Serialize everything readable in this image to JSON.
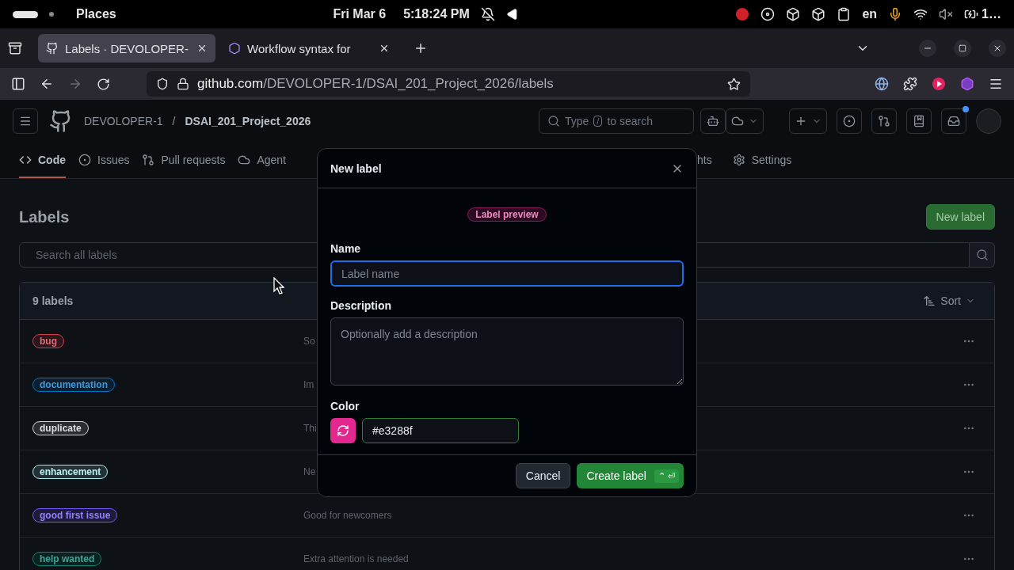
{
  "system_bar": {
    "workspace": "Places",
    "date": "Fri Mar 6",
    "time": "5:18:24 PM",
    "language": "en",
    "battery": "1…"
  },
  "browser": {
    "tabs": [
      {
        "title": "Labels · DEVOLOPER-",
        "selected": true
      },
      {
        "title": "Workflow syntax for",
        "selected": false
      }
    ],
    "url_domain": "github.com",
    "url_path": "/DEVOLOPER-1/DSAI_201_Project_2026/labels",
    "forward_disabled": true
  },
  "repo_header": {
    "owner": "DEVOLOPER-1",
    "separator": "/",
    "repo": "DSAI_201_Project_2026",
    "search": {
      "prefix": "Type",
      "key": "/",
      "suffix": "to search"
    },
    "unread_notifications": true
  },
  "repo_nav": {
    "left": [
      {
        "label": "Code",
        "selected": true
      },
      {
        "label": "Issues",
        "selected": false
      },
      {
        "label": "Pull requests",
        "selected": false
      },
      {
        "label": "Agent",
        "selected": false
      }
    ],
    "right": [
      {
        "label": "hts",
        "selected": false
      },
      {
        "label": "Settings",
        "selected": false
      }
    ]
  },
  "labels_page": {
    "title": "Labels",
    "new_label_button": "New label",
    "search": {
      "placeholder": "Search all labels"
    },
    "count": "9 labels",
    "sort": "Sort",
    "labels": [
      {
        "name": "bug",
        "color": "#d73a4a",
        "description": "So"
      },
      {
        "name": "documentation",
        "color": "#0075ca",
        "description": "Im"
      },
      {
        "name": "duplicate",
        "color": "#cfd3d7",
        "description": "Thi"
      },
      {
        "name": "enhancement",
        "color": "#a2eeef",
        "description": "Ne"
      },
      {
        "name": "good first issue",
        "color": "#7057ff",
        "description": "Good for newcomers"
      },
      {
        "name": "help wanted",
        "color": "#008672",
        "description": "Extra attention is needed"
      }
    ]
  },
  "dialog": {
    "title": "New label",
    "preview": "Label preview",
    "name": {
      "label": "Name",
      "placeholder": "Label name",
      "focused": true
    },
    "description": {
      "label": "Description",
      "placeholder": "Optionally add a description"
    },
    "color": {
      "label": "Color",
      "value": "#e3288f"
    },
    "buttons": {
      "cancel": "Cancel",
      "create": "Create label",
      "shortcut": "⌃ ⏎"
    }
  }
}
